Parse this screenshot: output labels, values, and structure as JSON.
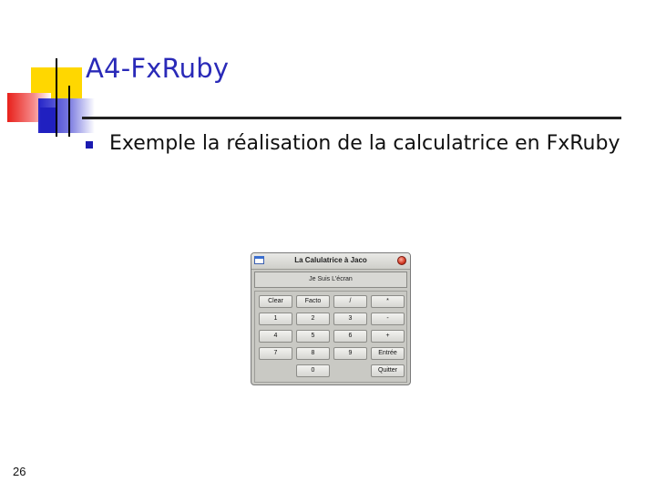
{
  "slide": {
    "title": "A4-FxRuby",
    "bullet": "Exemple la réalisation de la calculatrice en FxRuby",
    "page_number": "26"
  },
  "calculator": {
    "window_title": "La Calulatrice à Jaco",
    "display_text": "Je Suis L'écran",
    "buttons": {
      "clear": "Clear",
      "facto": "Facto",
      "divide": "/",
      "multiply": "*",
      "one": "1",
      "two": "2",
      "three": "3",
      "minus": "-",
      "four": "4",
      "five": "5",
      "six": "6",
      "plus": "+",
      "seven": "7",
      "eight": "8",
      "nine": "9",
      "enter": "Entrée",
      "zero": "0",
      "quit": "Quitter"
    }
  },
  "colors": {
    "title": "#2a2ab8",
    "bullet": "#1a1ab0",
    "logo_yellow": "#ffd700",
    "logo_red": "#e8201a",
    "logo_blue": "#2525c8"
  }
}
